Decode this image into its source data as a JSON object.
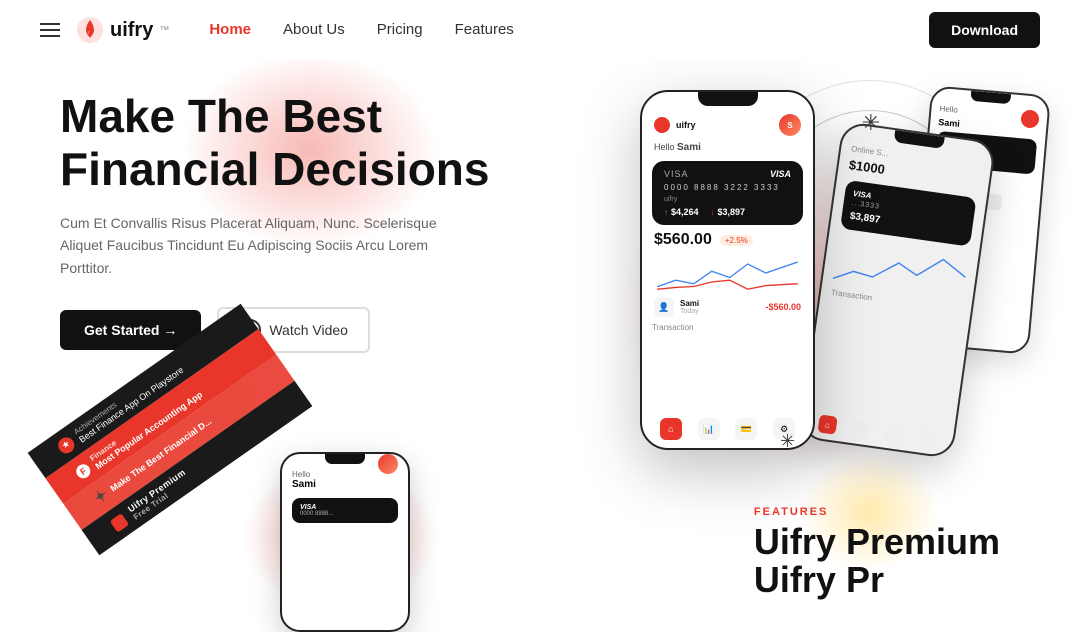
{
  "nav": {
    "hamburger_label": "☰",
    "logo_text": "uifry",
    "logo_sup": "™",
    "links": [
      {
        "label": "Home",
        "active": true
      },
      {
        "label": "About Us",
        "active": false
      },
      {
        "label": "Pricing",
        "active": false
      },
      {
        "label": "Features",
        "active": false
      }
    ],
    "download_label": "Download"
  },
  "hero": {
    "title_line1": "Make The Best",
    "title_line2": "Financial Decisions",
    "subtitle": "Cum Et Convallis Risus Placerat Aliquam, Nunc. Scelerisque Aliquet Faucibus Tincidunt Eu Adipiscing Sociis Arcu Lorem Porttitor.",
    "btn_get_started": "Get Started →",
    "btn_watch_video": "Watch Video"
  },
  "banner": {
    "achievements_label": "Achievements",
    "achievements_value": "Best Finance App On Playstore",
    "finance_label": "Finance",
    "finance_value": "Most Popular Accounting App",
    "promo_label": "Uifry Premium",
    "promo_value": "Free Trial",
    "make_best": "Make The Best Financial D..."
  },
  "phone_main": {
    "hello": "Hello",
    "name": "Sami",
    "balance": "$560.00",
    "balance_change": "+2.5%",
    "income": "$4,264",
    "expense": "$3,897",
    "transaction_name": "Sami",
    "transaction_amount": "-$560.00",
    "transaction_date": "Today"
  },
  "phone2": {
    "title": "Online S...",
    "stat": "$1000",
    "card_number": "3333",
    "amount": "$3,897"
  },
  "bottom": {
    "features_label": "FEATURES",
    "title_line1": "Uifry Premium",
    "title_start": "Uifry Pr"
  }
}
